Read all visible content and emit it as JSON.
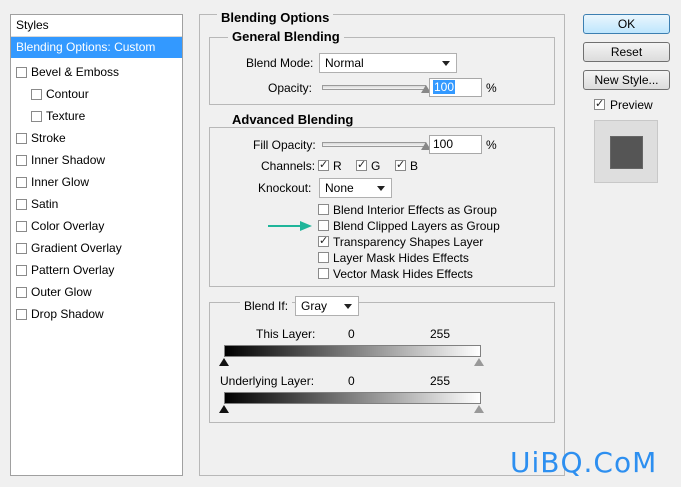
{
  "styles_panel": {
    "header": "Styles",
    "selected": "Blending Options: Custom",
    "items": [
      {
        "label": "Bevel & Emboss",
        "checked": false
      },
      {
        "label": "Contour",
        "checked": false,
        "sub": true
      },
      {
        "label": "Texture",
        "checked": false,
        "sub": true
      },
      {
        "label": "Stroke",
        "checked": false
      },
      {
        "label": "Inner Shadow",
        "checked": false
      },
      {
        "label": "Inner Glow",
        "checked": false
      },
      {
        "label": "Satin",
        "checked": false
      },
      {
        "label": "Color Overlay",
        "checked": false
      },
      {
        "label": "Gradient Overlay",
        "checked": false
      },
      {
        "label": "Pattern Overlay",
        "checked": false
      },
      {
        "label": "Outer Glow",
        "checked": false
      },
      {
        "label": "Drop Shadow",
        "checked": false
      }
    ]
  },
  "blending_options": {
    "title": "Blending Options",
    "general": {
      "title": "General Blending",
      "blend_mode_label": "Blend Mode:",
      "blend_mode_value": "Normal",
      "opacity_label": "Opacity:",
      "opacity_value": "100",
      "opacity_unit": "%",
      "opacity_level": 1.0
    },
    "advanced": {
      "title": "Advanced Blending",
      "fill_opacity_label": "Fill Opacity:",
      "fill_opacity_value": "100",
      "fill_opacity_unit": "%",
      "fill_opacity_level": 1.0,
      "channels_label": "Channels:",
      "channels": [
        {
          "label": "R",
          "checked": true
        },
        {
          "label": "G",
          "checked": true
        },
        {
          "label": "B",
          "checked": true
        }
      ],
      "knockout_label": "Knockout:",
      "knockout_value": "None",
      "options": [
        {
          "label": "Blend Interior Effects as Group",
          "checked": false
        },
        {
          "label": "Blend Clipped Layers as Group",
          "checked": false
        },
        {
          "label": "Transparency Shapes Layer",
          "checked": true
        },
        {
          "label": "Layer Mask Hides Effects",
          "checked": false
        },
        {
          "label": "Vector Mask Hides Effects",
          "checked": false
        }
      ]
    },
    "blend_if": {
      "label": "Blend If:",
      "value": "Gray",
      "this_layer_label": "This Layer:",
      "this_layer_min": "0",
      "this_layer_max": "255",
      "underlying_label": "Underlying Layer:",
      "underlying_min": "0",
      "underlying_max": "255"
    }
  },
  "buttons": {
    "ok": "OK",
    "reset": "Reset",
    "new_style": "New Style...",
    "preview_label": "Preview",
    "preview_checked": true
  },
  "watermark": "UiBQ.CoM",
  "colors": {
    "selection": "#3399ff",
    "arrow": "#1fb59a",
    "watermark": "#2d8ff0",
    "preview_swatch": "#555555"
  }
}
